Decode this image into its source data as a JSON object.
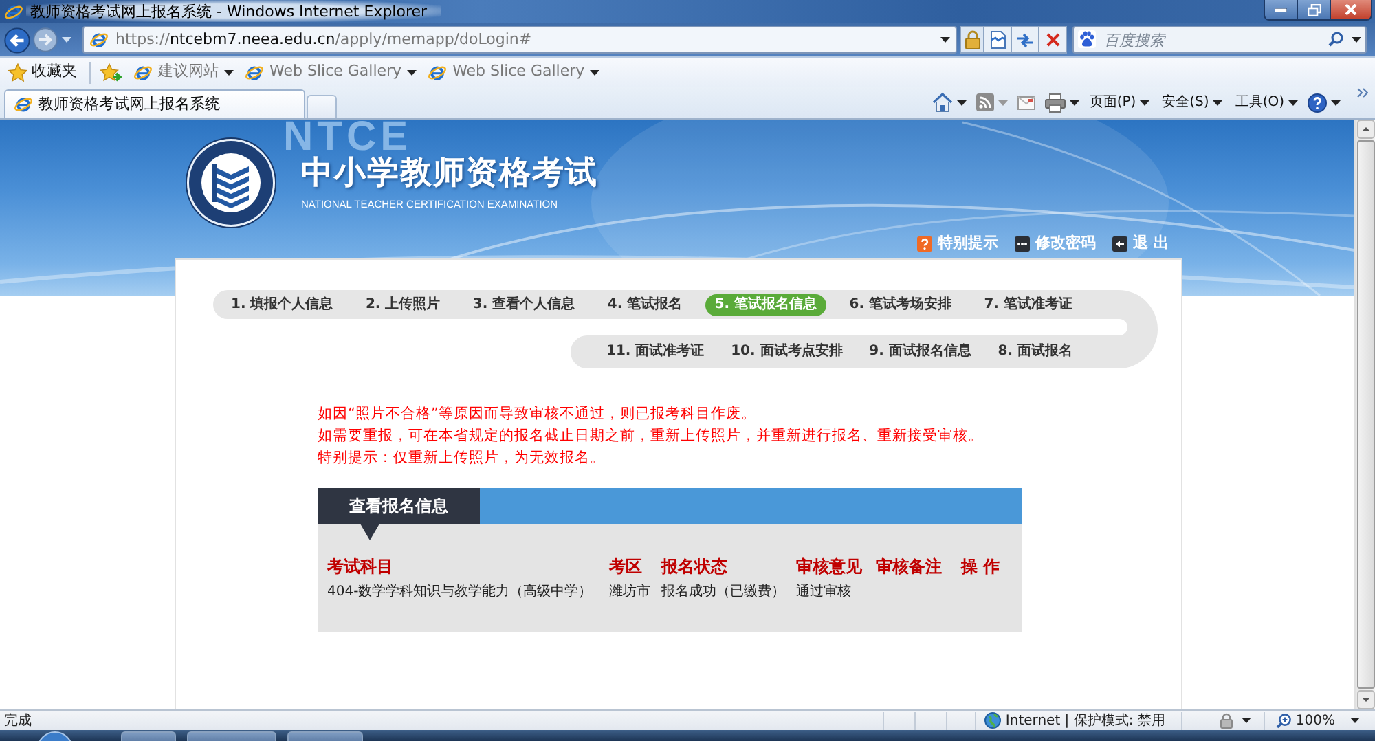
{
  "window": {
    "title": "教师资格考试网上报名系统 - Windows Internet Explorer"
  },
  "address_bar": {
    "url": "https://**ntcebm7.neea.edu.cn**/apply/memapp/doLogin#"
  },
  "search": {
    "placeholder": "百度搜索"
  },
  "favorites_bar": {
    "label": "收藏夹",
    "links": [
      {
        "label": "建议网站"
      },
      {
        "label": "Web Slice Gallery"
      },
      {
        "label": "Web Slice Gallery"
      }
    ]
  },
  "tabs": [
    {
      "title": "教师资格考试网上报名系统",
      "selected": true
    }
  ],
  "command_bar": {
    "menus": [
      {
        "label": "页面(P)"
      },
      {
        "label": "安全(S)"
      },
      {
        "label": "工具(O)"
      }
    ]
  },
  "page": {
    "header": {
      "background_letters": "NTCE",
      "title": "中小学教师资格考试",
      "subtitle": "NATIONAL TEACHER CERTIFICATION EXAMINATION",
      "links": [
        {
          "kind": "help",
          "label": "特别提示"
        },
        {
          "kind": "password",
          "label": "修改密码"
        },
        {
          "kind": "logout",
          "label": "退 出"
        }
      ]
    },
    "steps_row_1": [
      {
        "label": "1. 填报个人信息",
        "selected": false
      },
      {
        "label": "2. 上传照片",
        "selected": false
      },
      {
        "label": "3. 查看个人信息",
        "selected": false
      },
      {
        "label": "4. 笔试报名",
        "selected": false
      },
      {
        "label": "5. 笔试报名信息",
        "selected": true
      },
      {
        "label": "6. 笔试考场安排",
        "selected": false
      },
      {
        "label": "7. 笔试准考证",
        "selected": false
      }
    ],
    "steps_row_2": [
      {
        "label": "11. 面试准考证",
        "selected": false
      },
      {
        "label": "10. 面试考点安排",
        "selected": false
      },
      {
        "label": "9. 面试报名信息",
        "selected": false
      },
      {
        "label": "8. 面试报名",
        "selected": false
      }
    ],
    "notice": [
      "如因“照片不合格”等原因而导致审核不通过，则已报考科目作废。",
      "如需要重报，可在本省规定的报名截止日期之前，重新上传照片，并重新进行报名、重新接受审核。",
      "特别提示：仅重新上传照片，为无效报名。"
    ],
    "panel": {
      "title": "查看报名信息",
      "table": {
        "columns": [
          "考试科目",
          "考区",
          "报名状态",
          "审核意见",
          "审核备注",
          "操 作"
        ],
        "rows": [
          [
            "404-数学学科知识与教学能力（高级中学）",
            "潍坊市",
            "报名成功（已缴费）",
            "通过审核"
          ]
        ]
      }
    }
  },
  "status_bar": {
    "text": "完成",
    "zone": "Internet | 保护模式: 禁用",
    "zoom": "100%"
  }
}
